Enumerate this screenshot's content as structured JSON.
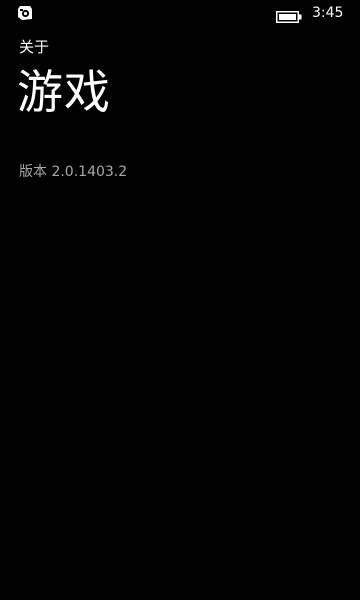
{
  "status_bar": {
    "app_icon": "game-app-icon",
    "battery_icon": "battery-icon",
    "time": "3:45"
  },
  "about": {
    "section_label": "关于",
    "app_name": "游戏",
    "version_label": "版本",
    "version_value": "2.0.1403.2"
  },
  "colors": {
    "background": "#000000",
    "primary_text": "#ffffff",
    "secondary_text": "#a8a8a8"
  }
}
